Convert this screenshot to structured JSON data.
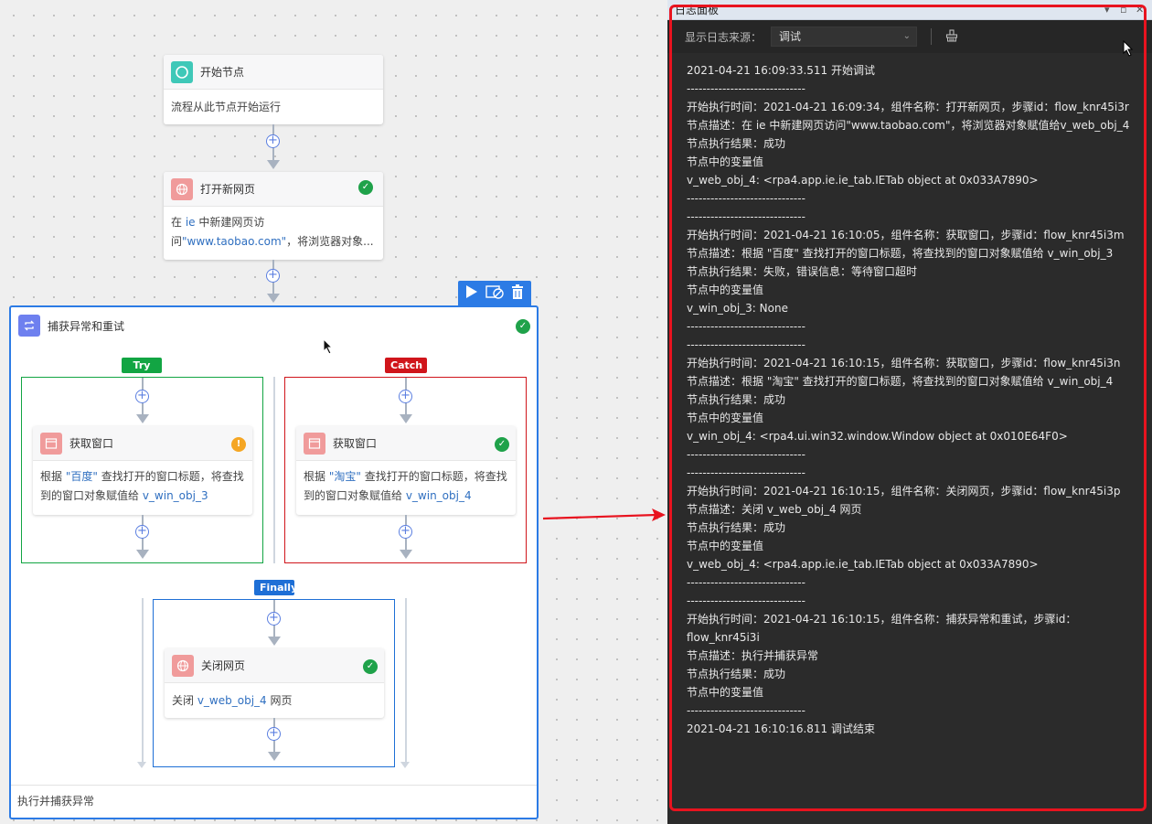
{
  "flow": {
    "start": {
      "title": "开始节点",
      "desc": "流程从此节点开始运行"
    },
    "open_page": {
      "title": "打开新网页",
      "desc_pre": "在 ",
      "desc_hl1": "ie",
      "desc_mid": " 中新建网页访问",
      "desc_hl2": "\"www.taobao.com\"",
      "desc_post": "，将浏览器对象...",
      "status": "success"
    },
    "try_catch": {
      "title": "捕获异常和重试",
      "footer": "执行并捕获异常",
      "try_label": "Try",
      "catch_label": "Catch",
      "finally_label": "Finally",
      "try_node": {
        "title": "获取窗口",
        "desc_pre": "根据 ",
        "desc_hl1": "\"百度\"",
        "desc_mid": " 查找打开的窗口标题，将查找到的窗口对象赋值给 ",
        "desc_hl2": "v_win_obj_3",
        "status": "warning"
      },
      "catch_node": {
        "title": "获取窗口",
        "desc_pre": "根据 ",
        "desc_hl1": "\"淘宝\"",
        "desc_mid": " 查找打开的窗口标题，将查找到的窗口对象赋值给 ",
        "desc_hl2": "v_win_obj_4",
        "status": "success"
      },
      "finally_node": {
        "title": "关闭网页",
        "desc_pre": "关闭 ",
        "desc_hl": "v_web_obj_4",
        "desc_post": " 网页",
        "status": "success"
      }
    }
  },
  "log_panel": {
    "title": "日志面板",
    "source_label": "显示日志来源：",
    "source_value": "调试",
    "lines": [
      "2021-04-21 16:09:33.511 开始调试",
      "------------------------------",
      "开始执行时间：2021-04-21 16:09:34，组件名称：打开新网页，步骤id：flow_knr45i3r",
      "节点描述：在 ie 中新建网页访问\"www.taobao.com\"，将浏览器对象赋值给v_web_obj_4",
      "节点执行结果：成功",
      "节点中的变量值",
      "v_web_obj_4: <rpa4.app.ie.ie_tab.IETab object at 0x033A7890>",
      "------------------------------",
      "------------------------------",
      "开始执行时间：2021-04-21 16:10:05，组件名称：获取窗口，步骤id：flow_knr45i3m",
      "节点描述：根据 \"百度\" 查找打开的窗口标题，将查找到的窗口对象赋值给 v_win_obj_3",
      "节点执行结果：失败，错误信息：等待窗口超时",
      "节点中的变量值",
      "v_win_obj_3: None",
      "------------------------------",
      "------------------------------",
      "开始执行时间：2021-04-21 16:10:15，组件名称：获取窗口，步骤id：flow_knr45i3n",
      "节点描述：根据 \"淘宝\" 查找打开的窗口标题，将查找到的窗口对象赋值给 v_win_obj_4",
      "节点执行结果：成功",
      "节点中的变量值",
      "v_win_obj_4: <rpa4.ui.win32.window.Window object at 0x010E64F0>",
      "------------------------------",
      "------------------------------",
      "开始执行时间：2021-04-21 16:10:15，组件名称：关闭网页，步骤id：flow_knr45i3p",
      "节点描述：关闭 v_web_obj_4 网页",
      "节点执行结果：成功",
      "节点中的变量值",
      "v_web_obj_4: <rpa4.app.ie.ie_tab.IETab object at 0x033A7890>",
      "------------------------------",
      "------------------------------",
      "开始执行时间：2021-04-21 16:10:15，组件名称：捕获异常和重试，步骤id：",
      "flow_knr45i3i",
      "节点描述：执行并捕获异常",
      "节点执行结果：成功",
      "节点中的变量值",
      "------------------------------",
      "2021-04-21 16:10:16.811 调试结束"
    ]
  },
  "colors": {
    "try": "#12a543",
    "catch": "#d0151b",
    "finally": "#1e6fd6",
    "highlight_frame": "#e8131f"
  }
}
